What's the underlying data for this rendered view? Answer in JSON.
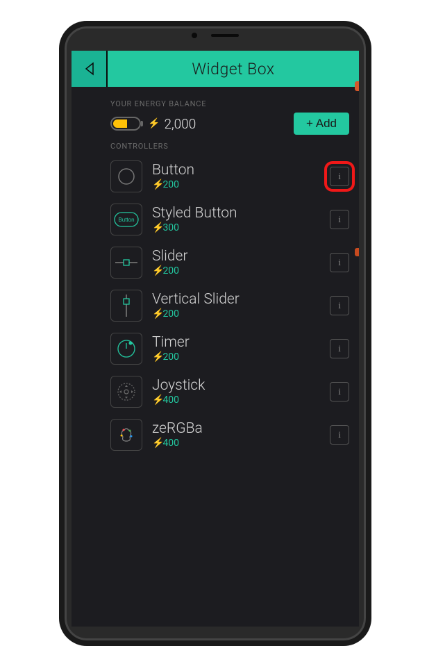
{
  "header": {
    "title": "Widget Box"
  },
  "balance": {
    "section_label": "YOUR ENERGY BALANCE",
    "amount": "2,000",
    "add_label": "+ Add"
  },
  "controllers": {
    "section_label": "CONTROLLERS",
    "items": [
      {
        "name": "Button",
        "cost": "200",
        "icon": "circle",
        "highlight_info": true
      },
      {
        "name": "Styled Button",
        "cost": "300",
        "icon": "styled",
        "highlight_info": false
      },
      {
        "name": "Slider",
        "cost": "200",
        "icon": "h-slider",
        "highlight_info": false
      },
      {
        "name": "Vertical Slider",
        "cost": "200",
        "icon": "v-slider",
        "highlight_info": false
      },
      {
        "name": "Timer",
        "cost": "200",
        "icon": "timer",
        "highlight_info": false
      },
      {
        "name": "Joystick",
        "cost": "400",
        "icon": "joystick",
        "highlight_info": false
      },
      {
        "name": "zeRGBa",
        "cost": "400",
        "icon": "zergba",
        "highlight_info": false
      }
    ]
  }
}
